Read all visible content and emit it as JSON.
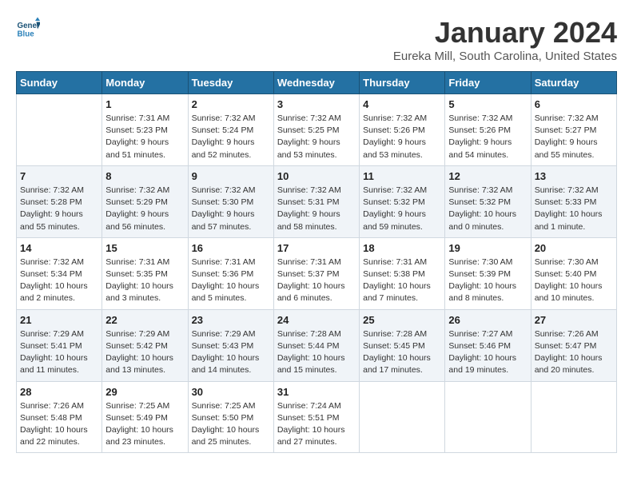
{
  "header": {
    "logo_line1": "General",
    "logo_line2": "Blue",
    "month": "January 2024",
    "location": "Eureka Mill, South Carolina, United States"
  },
  "weekdays": [
    "Sunday",
    "Monday",
    "Tuesday",
    "Wednesday",
    "Thursday",
    "Friday",
    "Saturday"
  ],
  "weeks": [
    [
      {
        "day": "",
        "sunrise": "",
        "sunset": "",
        "daylight": ""
      },
      {
        "day": "1",
        "sunrise": "7:31 AM",
        "sunset": "5:23 PM",
        "daylight": "9 hours and 51 minutes."
      },
      {
        "day": "2",
        "sunrise": "7:32 AM",
        "sunset": "5:24 PM",
        "daylight": "9 hours and 52 minutes."
      },
      {
        "day": "3",
        "sunrise": "7:32 AM",
        "sunset": "5:25 PM",
        "daylight": "9 hours and 53 minutes."
      },
      {
        "day": "4",
        "sunrise": "7:32 AM",
        "sunset": "5:26 PM",
        "daylight": "9 hours and 53 minutes."
      },
      {
        "day": "5",
        "sunrise": "7:32 AM",
        "sunset": "5:26 PM",
        "daylight": "9 hours and 54 minutes."
      },
      {
        "day": "6",
        "sunrise": "7:32 AM",
        "sunset": "5:27 PM",
        "daylight": "9 hours and 55 minutes."
      }
    ],
    [
      {
        "day": "7",
        "sunrise": "7:32 AM",
        "sunset": "5:28 PM",
        "daylight": "9 hours and 55 minutes."
      },
      {
        "day": "8",
        "sunrise": "7:32 AM",
        "sunset": "5:29 PM",
        "daylight": "9 hours and 56 minutes."
      },
      {
        "day": "9",
        "sunrise": "7:32 AM",
        "sunset": "5:30 PM",
        "daylight": "9 hours and 57 minutes."
      },
      {
        "day": "10",
        "sunrise": "7:32 AM",
        "sunset": "5:31 PM",
        "daylight": "9 hours and 58 minutes."
      },
      {
        "day": "11",
        "sunrise": "7:32 AM",
        "sunset": "5:32 PM",
        "daylight": "9 hours and 59 minutes."
      },
      {
        "day": "12",
        "sunrise": "7:32 AM",
        "sunset": "5:32 PM",
        "daylight": "10 hours and 0 minutes."
      },
      {
        "day": "13",
        "sunrise": "7:32 AM",
        "sunset": "5:33 PM",
        "daylight": "10 hours and 1 minute."
      }
    ],
    [
      {
        "day": "14",
        "sunrise": "7:32 AM",
        "sunset": "5:34 PM",
        "daylight": "10 hours and 2 minutes."
      },
      {
        "day": "15",
        "sunrise": "7:31 AM",
        "sunset": "5:35 PM",
        "daylight": "10 hours and 3 minutes."
      },
      {
        "day": "16",
        "sunrise": "7:31 AM",
        "sunset": "5:36 PM",
        "daylight": "10 hours and 5 minutes."
      },
      {
        "day": "17",
        "sunrise": "7:31 AM",
        "sunset": "5:37 PM",
        "daylight": "10 hours and 6 minutes."
      },
      {
        "day": "18",
        "sunrise": "7:31 AM",
        "sunset": "5:38 PM",
        "daylight": "10 hours and 7 minutes."
      },
      {
        "day": "19",
        "sunrise": "7:30 AM",
        "sunset": "5:39 PM",
        "daylight": "10 hours and 8 minutes."
      },
      {
        "day": "20",
        "sunrise": "7:30 AM",
        "sunset": "5:40 PM",
        "daylight": "10 hours and 10 minutes."
      }
    ],
    [
      {
        "day": "21",
        "sunrise": "7:29 AM",
        "sunset": "5:41 PM",
        "daylight": "10 hours and 11 minutes."
      },
      {
        "day": "22",
        "sunrise": "7:29 AM",
        "sunset": "5:42 PM",
        "daylight": "10 hours and 13 minutes."
      },
      {
        "day": "23",
        "sunrise": "7:29 AM",
        "sunset": "5:43 PM",
        "daylight": "10 hours and 14 minutes."
      },
      {
        "day": "24",
        "sunrise": "7:28 AM",
        "sunset": "5:44 PM",
        "daylight": "10 hours and 15 minutes."
      },
      {
        "day": "25",
        "sunrise": "7:28 AM",
        "sunset": "5:45 PM",
        "daylight": "10 hours and 17 minutes."
      },
      {
        "day": "26",
        "sunrise": "7:27 AM",
        "sunset": "5:46 PM",
        "daylight": "10 hours and 19 minutes."
      },
      {
        "day": "27",
        "sunrise": "7:26 AM",
        "sunset": "5:47 PM",
        "daylight": "10 hours and 20 minutes."
      }
    ],
    [
      {
        "day": "28",
        "sunrise": "7:26 AM",
        "sunset": "5:48 PM",
        "daylight": "10 hours and 22 minutes."
      },
      {
        "day": "29",
        "sunrise": "7:25 AM",
        "sunset": "5:49 PM",
        "daylight": "10 hours and 23 minutes."
      },
      {
        "day": "30",
        "sunrise": "7:25 AM",
        "sunset": "5:50 PM",
        "daylight": "10 hours and 25 minutes."
      },
      {
        "day": "31",
        "sunrise": "7:24 AM",
        "sunset": "5:51 PM",
        "daylight": "10 hours and 27 minutes."
      },
      {
        "day": "",
        "sunrise": "",
        "sunset": "",
        "daylight": ""
      },
      {
        "day": "",
        "sunrise": "",
        "sunset": "",
        "daylight": ""
      },
      {
        "day": "",
        "sunrise": "",
        "sunset": "",
        "daylight": ""
      }
    ]
  ],
  "labels": {
    "sunrise": "Sunrise:",
    "sunset": "Sunset:",
    "daylight": "Daylight:"
  }
}
